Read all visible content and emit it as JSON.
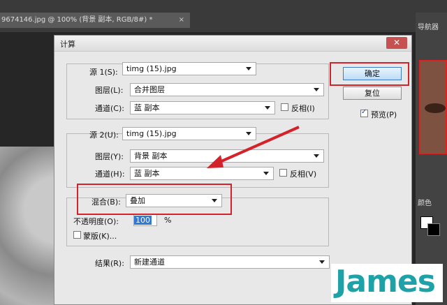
{
  "photoshop": {
    "document_tab": "9674146.jpg @ 100% (背景 副本, RGB/8#) *",
    "document_tab_close": "×",
    "navigator_title": "导航器",
    "color_panel_title": "颜色"
  },
  "dialog": {
    "title": "计算",
    "close": "✕",
    "source1": {
      "label": "源 1(S):",
      "file": "timg (15).jpg",
      "layer_label": "图层(L):",
      "layer": "合并图层",
      "channel_label": "通道(C):",
      "channel": "蓝 副本",
      "invert_label": "反相(I)",
      "invert_checked": false
    },
    "source2": {
      "label": "源 2(U):",
      "file": "timg (15).jpg",
      "layer_label": "图层(Y):",
      "layer": "背景 副本",
      "channel_label": "通道(H):",
      "channel": "蓝 副本",
      "invert_label": "反相(V)",
      "invert_checked": false
    },
    "blending": {
      "label": "混合(B):",
      "mode": "叠加",
      "opacity_label": "不透明度(O):",
      "opacity_value": "100",
      "opacity_unit": "%",
      "mask_label": "蒙版(K)...",
      "mask_checked": false
    },
    "result": {
      "label": "结果(R):",
      "value": "新建通道"
    },
    "buttons": {
      "ok": "确定",
      "reset": "复位"
    },
    "preview": {
      "label": "预览(P)",
      "checked": true
    }
  },
  "annotations": {
    "highlight_color": "#d3222a"
  },
  "watermark": {
    "text": "James",
    "color": "#1ea2a8"
  }
}
